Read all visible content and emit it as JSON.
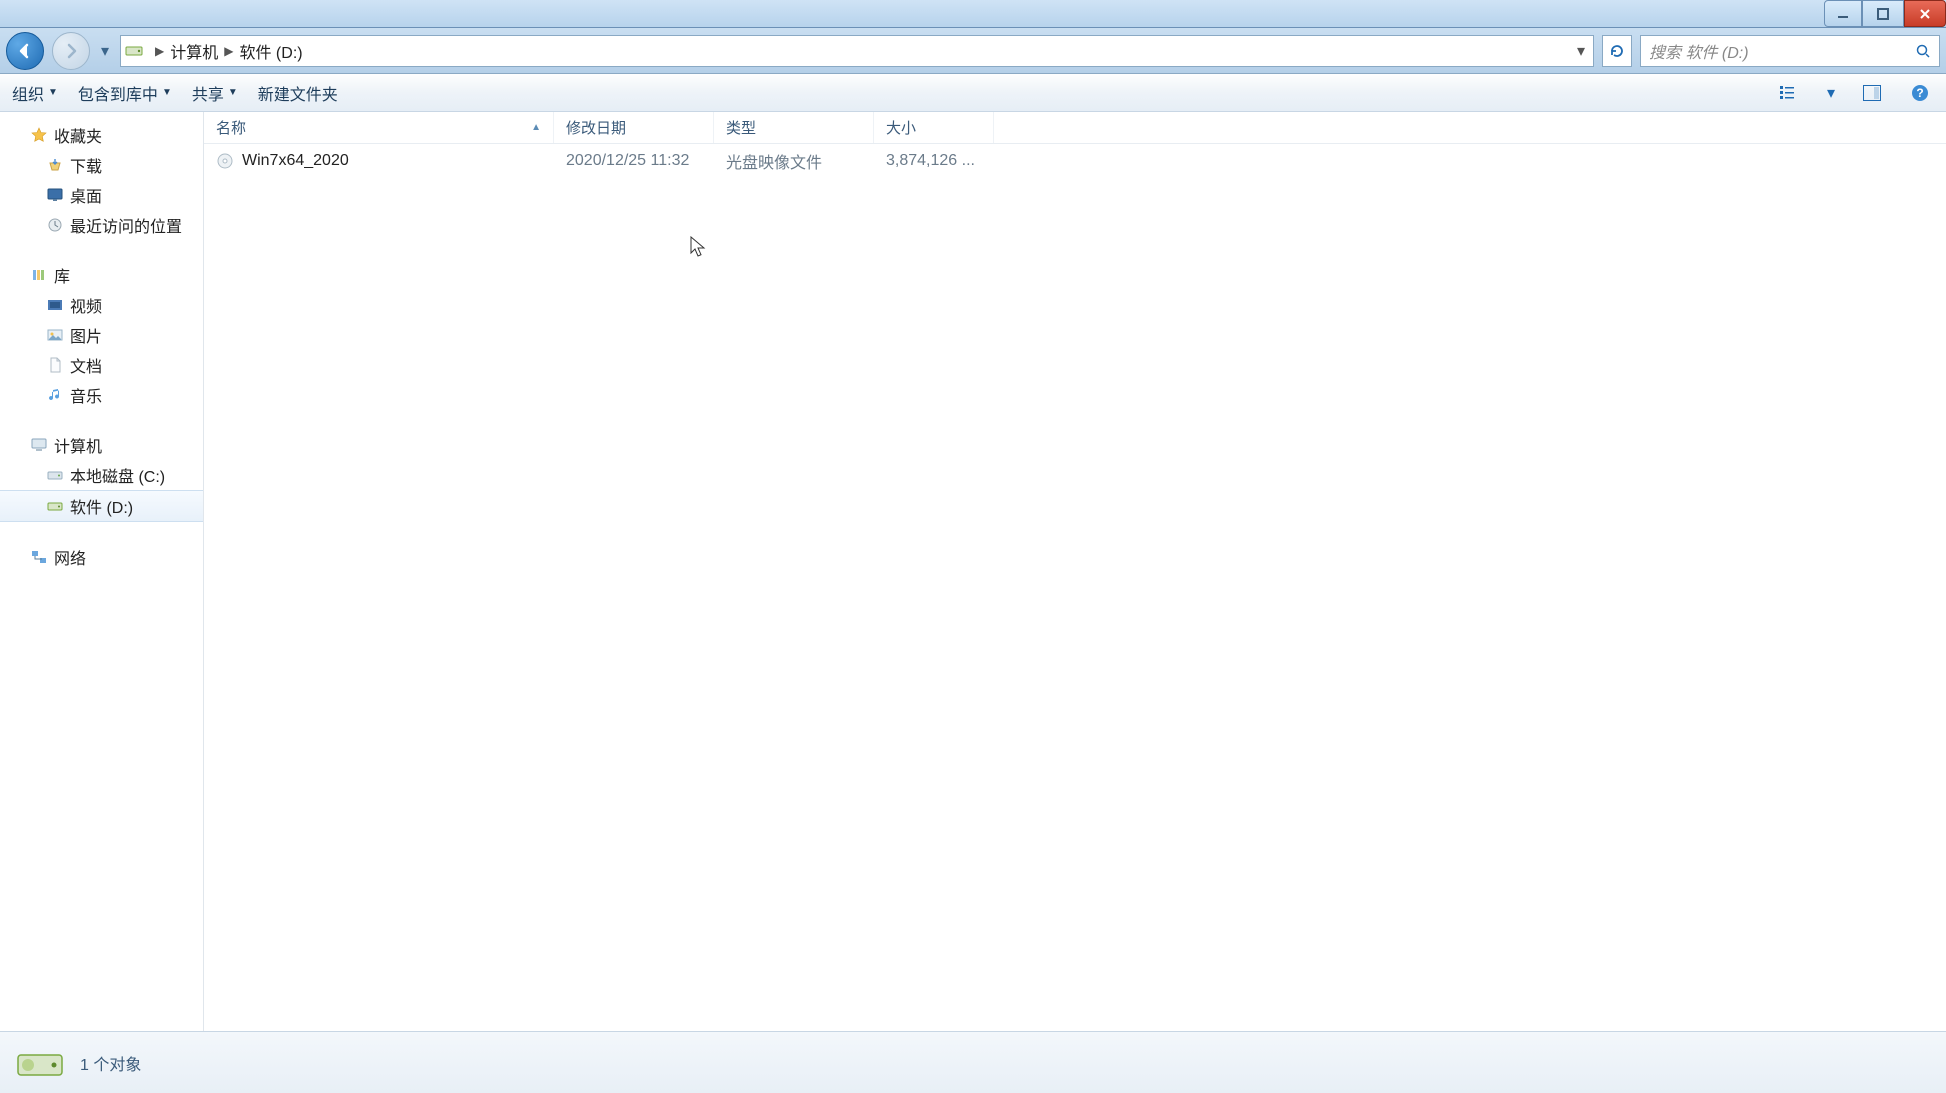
{
  "breadcrumb": {
    "part1": "计算机",
    "part2": "软件 (D:)"
  },
  "search_placeholder": "搜索 软件 (D:)",
  "toolbar": {
    "organize": "组织",
    "include": "包含到库中",
    "share": "共享",
    "new_folder": "新建文件夹"
  },
  "columns": {
    "name": "名称",
    "date": "修改日期",
    "type": "类型",
    "size": "大小"
  },
  "files": [
    {
      "name": "Win7x64_2020",
      "date": "2020/12/25 11:32",
      "type": "光盘映像文件",
      "size": "3,874,126 ..."
    }
  ],
  "sidebar": {
    "favorites": "收藏夹",
    "downloads": "下载",
    "desktop": "桌面",
    "recent": "最近访问的位置",
    "libraries": "库",
    "videos": "视频",
    "pictures": "图片",
    "documents": "文档",
    "music": "音乐",
    "computer": "计算机",
    "drive_c": "本地磁盘 (C:)",
    "drive_d": "软件 (D:)",
    "network": "网络"
  },
  "status": {
    "count": "1 个对象"
  }
}
